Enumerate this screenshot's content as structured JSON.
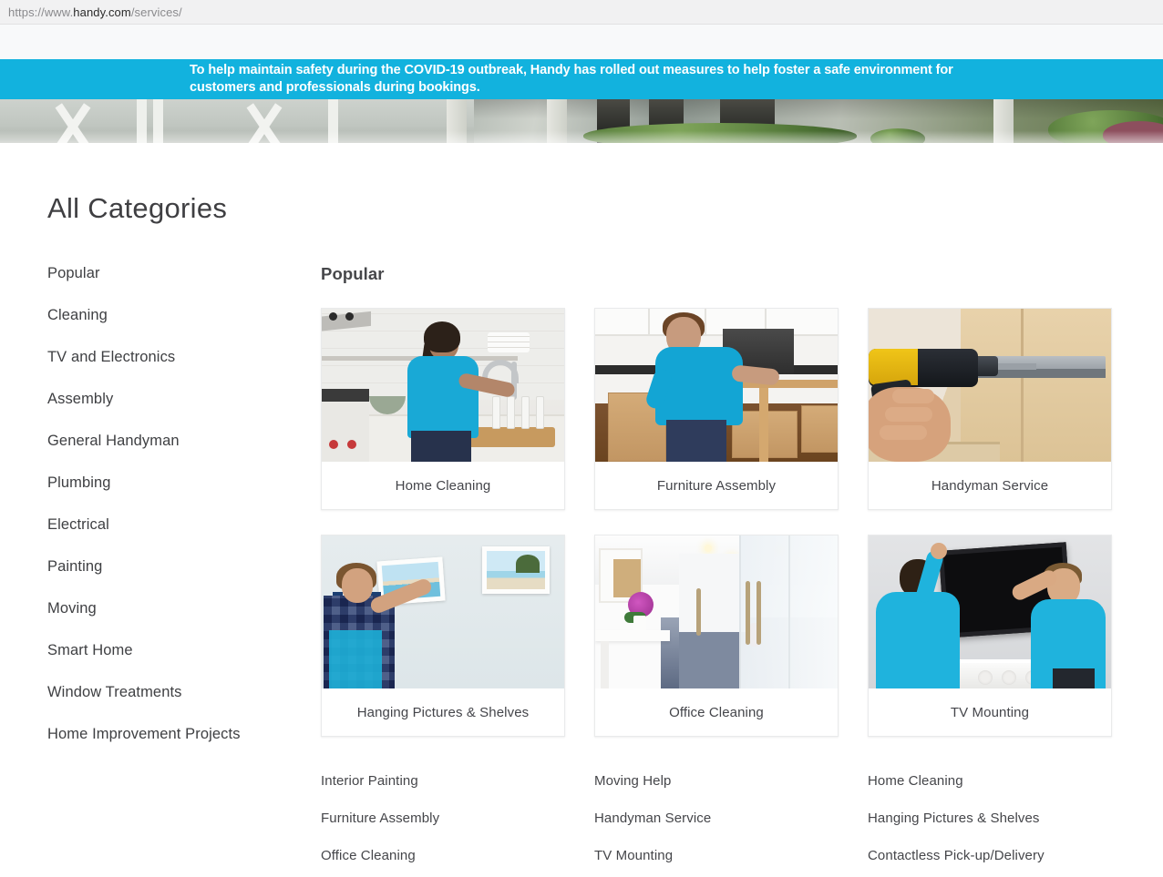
{
  "browser": {
    "url_prefix": "https://www.",
    "url_host": "handy.com",
    "url_path": "/services/"
  },
  "banner": {
    "text": "To help maintain safety during the COVID-19 outbreak, Handy has rolled out measures to help foster a safe environment for customers and professionals during bookings.",
    "background_color": "#12b2de",
    "text_color": "#ffffff"
  },
  "hero": {
    "alt": "house-exterior-photo-strip"
  },
  "page": {
    "title": "All Categories"
  },
  "sidebar": {
    "items": [
      {
        "label": "Popular"
      },
      {
        "label": "Cleaning"
      },
      {
        "label": "TV and Electronics"
      },
      {
        "label": "Assembly"
      },
      {
        "label": "General Handyman"
      },
      {
        "label": "Plumbing"
      },
      {
        "label": "Electrical"
      },
      {
        "label": "Painting"
      },
      {
        "label": "Moving"
      },
      {
        "label": "Smart Home"
      },
      {
        "label": "Window Treatments"
      },
      {
        "label": "Home Improvement Projects"
      }
    ]
  },
  "main": {
    "section_title": "Popular",
    "cards": [
      {
        "label": "Home Cleaning",
        "image": "woman-washing-dishes-kitchen"
      },
      {
        "label": "Furniture Assembly",
        "image": "man-assembling-table-boxes"
      },
      {
        "label": "Handyman Service",
        "image": "drill-installing-drawer-slide"
      },
      {
        "label": "Hanging Pictures & Shelves",
        "image": "man-hanging-framed-picture"
      },
      {
        "label": "Office Cleaning",
        "image": "white-office-corridor-orchid"
      },
      {
        "label": "TV Mounting",
        "image": "two-men-mounting-tv"
      }
    ],
    "link_columns": [
      {
        "links": [
          "Interior Painting",
          "Furniture Assembly",
          "Office Cleaning"
        ]
      },
      {
        "links": [
          "Moving Help",
          "Handyman Service",
          "TV Mounting"
        ]
      },
      {
        "links": [
          "Home Cleaning",
          "Hanging Pictures & Shelves",
          "Contactless Pick-up/Delivery"
        ]
      }
    ]
  }
}
